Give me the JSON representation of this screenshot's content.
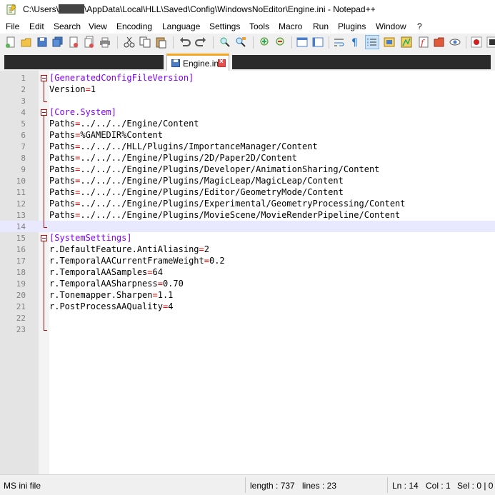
{
  "window": {
    "title_prefix": "C:\\Users\\",
    "title_suffix": "\\AppData\\Local\\HLL\\Saved\\Config\\WindowsNoEditor\\Engine.ini - Notepad++"
  },
  "menu": [
    "File",
    "Edit",
    "Search",
    "View",
    "Encoding",
    "Language",
    "Settings",
    "Tools",
    "Macro",
    "Run",
    "Plugins",
    "Window",
    "?"
  ],
  "toolbar_icons": [
    "new-file-icon",
    "open-file-icon",
    "save-icon",
    "save-all-icon",
    "close-icon",
    "close-all-icon",
    "print-icon",
    "cut-icon",
    "copy-icon",
    "paste-icon",
    "undo-icon",
    "redo-icon",
    "find-icon",
    "replace-icon",
    "zoom-in-icon",
    "zoom-out-icon",
    "sync-vertical-icon",
    "sync-horizontal-icon",
    "word-wrap-icon",
    "show-all-chars-icon",
    "indent-guide-icon",
    "udl-icon",
    "doc-map-icon",
    "function-list-icon",
    "folder-workspace-icon",
    "monitoring-icon",
    "record-macro-icon"
  ],
  "tabs": {
    "active_label": "Engine.ini"
  },
  "editor": {
    "current_line": 14,
    "lines": [
      {
        "n": "1",
        "type": "section",
        "text": "[GeneratedConfigFileVersion]"
      },
      {
        "n": "2",
        "type": "kv",
        "key": "Version",
        "val": "1"
      },
      {
        "n": "3",
        "type": "blank"
      },
      {
        "n": "4",
        "type": "section",
        "text": "[Core.System]"
      },
      {
        "n": "5",
        "type": "kv",
        "key": "Paths",
        "val": "../../../Engine/Content"
      },
      {
        "n": "6",
        "type": "kv",
        "key": "Paths",
        "val": "%GAMEDIR%Content"
      },
      {
        "n": "7",
        "type": "kv",
        "key": "Paths",
        "val": "../../../HLL/Plugins/ImportanceManager/Content"
      },
      {
        "n": "8",
        "type": "kv",
        "key": "Paths",
        "val": "../../../Engine/Plugins/2D/Paper2D/Content"
      },
      {
        "n": "9",
        "type": "kv",
        "key": "Paths",
        "val": "../../../Engine/Plugins/Developer/AnimationSharing/Content"
      },
      {
        "n": "10",
        "type": "kv",
        "key": "Paths",
        "val": "../../../Engine/Plugins/MagicLeap/MagicLeap/Content"
      },
      {
        "n": "11",
        "type": "kv",
        "key": "Paths",
        "val": "../../../Engine/Plugins/Editor/GeometryMode/Content"
      },
      {
        "n": "12",
        "type": "kv",
        "key": "Paths",
        "val": "../../../Engine/Plugins/Experimental/GeometryProcessing/Content"
      },
      {
        "n": "13",
        "type": "kv",
        "key": "Paths",
        "val": "../../../Engine/Plugins/MovieScene/MovieRenderPipeline/Content"
      },
      {
        "n": "14",
        "type": "blank"
      },
      {
        "n": "15",
        "type": "section",
        "text": "[SystemSettings]"
      },
      {
        "n": "16",
        "type": "kv",
        "key": "r.DefaultFeature.AntiAliasing",
        "val": "2"
      },
      {
        "n": "17",
        "type": "kv",
        "key": "r.TemporalAACurrentFrameWeight",
        "val": "0.2"
      },
      {
        "n": "18",
        "type": "kv",
        "key": "r.TemporalAASamples",
        "val": "64"
      },
      {
        "n": "19",
        "type": "kv",
        "key": "r.TemporalAASharpness",
        "val": "0.70"
      },
      {
        "n": "20",
        "type": "kv",
        "key": "r.Tonemapper.Sharpen",
        "val": "1.1"
      },
      {
        "n": "21",
        "type": "kv",
        "key": "r.PostProcessAAQuality",
        "val": "4"
      },
      {
        "n": "22",
        "type": "blank"
      },
      {
        "n": "23",
        "type": "blank"
      }
    ]
  },
  "status": {
    "filetype": "MS ini file",
    "length": "length : 737",
    "lines": "lines : 23",
    "ln": "Ln : 14",
    "col": "Col : 1",
    "sel": "Sel : 0 | 0"
  },
  "colors": {
    "section": "#8000ff",
    "equals": "#ff0000",
    "current_line": "#e8e8ff",
    "tab_accent": "#f5a623"
  }
}
